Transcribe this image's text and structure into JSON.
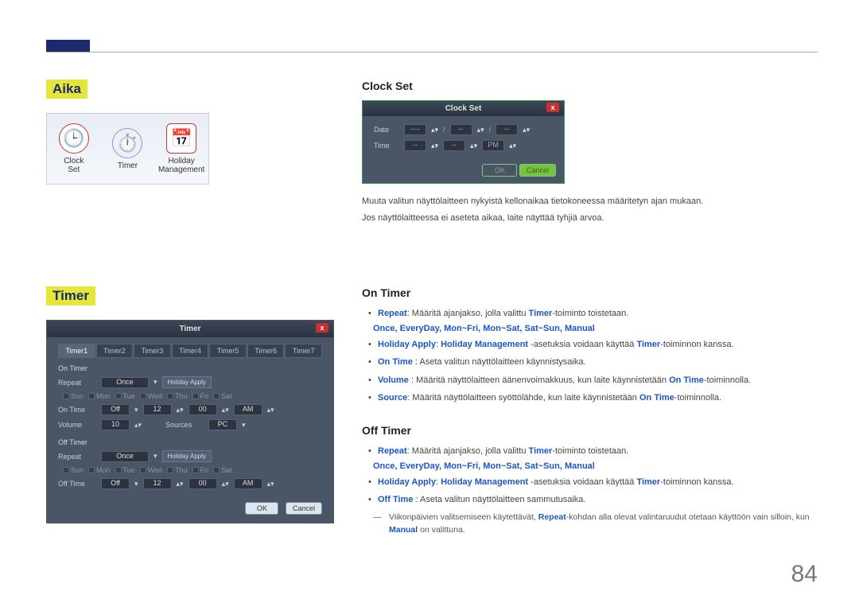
{
  "page_number": "84",
  "left": {
    "aika": {
      "label": "Aika",
      "items": [
        {
          "icon": "🕒",
          "label_l1": "Clock",
          "label_l2": "Set"
        },
        {
          "icon": "⏱️",
          "label_l1": "Timer",
          "label_l2": " "
        },
        {
          "icon": "📅",
          "label_l1": "Holiday",
          "label_l2": "Management"
        }
      ]
    },
    "timer": {
      "label": "Timer",
      "dialog_title": "Timer",
      "close": "x",
      "tabs": [
        "Timer1",
        "Timer2",
        "Timer3",
        "Timer4",
        "Timer5",
        "Timer6",
        "Timer7"
      ],
      "on_timer_title": "On Timer",
      "off_timer_title": "Off Timer",
      "repeat_label": "Repeat",
      "repeat_value": "Once",
      "holiday_apply_btn": "Holiday Apply",
      "days": [
        "Sun",
        "Mon",
        "Tue",
        "Wed",
        "Thu",
        "Fri",
        "Sat"
      ],
      "ontime_label": "On Time",
      "ontime_state": "Off",
      "hour": "12",
      "min": "00",
      "ampm": "AM",
      "volume_label": "Volume",
      "volume_value": "10",
      "sources_label": "Sources",
      "sources_value": "PC",
      "offtime_label": "Off Time",
      "offtime_state": "Off",
      "ok": "OK",
      "cancel": "Cancel"
    }
  },
  "right": {
    "clockset": {
      "heading": "Clock Set",
      "dialog_title": "Clock Set",
      "close": "x",
      "date_label": "Date",
      "time_label": "Time",
      "dash": "--",
      "slash": "/",
      "colon": "----",
      "pm": "PM",
      "ok": "OK",
      "cancel": "Cancel",
      "para1": "Muuta valitun näyttölaitteen nykyistä kellonaikaa tietokoneessa määritetyn ajan mukaan.",
      "para2": "Jos näyttölaitteessa ei aseteta aikaa, laite näyttää tyhjiä arvoa."
    },
    "ontimer": {
      "heading": "On Timer",
      "b1_term": "Repeat",
      "b1_text": ": Määritä ajanjakso, jolla valittu ",
      "b1_term2": "Timer",
      "b1_tail": "-toiminto toistetaan.",
      "options": "Once, EveryDay, Mon~Fri, Mon~Sat, Sat~Sun, Manual",
      "b2_term": "Holiday Apply",
      "b2_term2": "Holiday Management",
      "b2_text": " -asetuksia voidaan käyttää ",
      "b2_term3": "Timer",
      "b2_tail": "-toiminnon kanssa.",
      "b3_term": "On Time",
      "b3_text": " : Aseta valitun näyttölaitteen käynnistysaika.",
      "b4_term": "Volume",
      "b4_text": " : Määritä näyttölaitteen äänenvoimakkuus, kun laite käynnistetään ",
      "b4_term2": "On Time",
      "b4_tail": "-toiminnolla.",
      "b5_term": "Source",
      "b5_text": ": Määritä näyttölaitteen syöttölähde, kun laite käynnistetään ",
      "b5_term2": "On Time",
      "b5_tail": "-toiminnolla."
    },
    "offtimer": {
      "heading": "Off Timer",
      "b1_term": "Repeat",
      "b1_text": ": Määritä ajanjakso, jolla valittu ",
      "b1_term2": "Timer",
      "b1_tail": "-toiminto toistetaan.",
      "options": "Once, EveryDay, Mon~Fri, Mon~Sat, Sat~Sun, Manual",
      "b2_term": "Holiday Apply",
      "b2_term2": "Holiday Management",
      "b2_text": " -asetuksia voidaan käyttää ",
      "b2_term3": "Timer",
      "b2_tail": "-toiminnon kanssa.",
      "b3_term": "Off Time",
      "b3_text": " : Aseta valitun näyttölaitteen sammutusaika.",
      "note_pre": "Viikonpäivien valitsemiseen käytettävät, ",
      "note_term": "Repeat",
      "note_mid": "-kohdan alla olevat valintaruudut otetaan käyttöön vain silloin, kun ",
      "note_term2": "Manual",
      "note_tail": " on valittuna."
    }
  }
}
